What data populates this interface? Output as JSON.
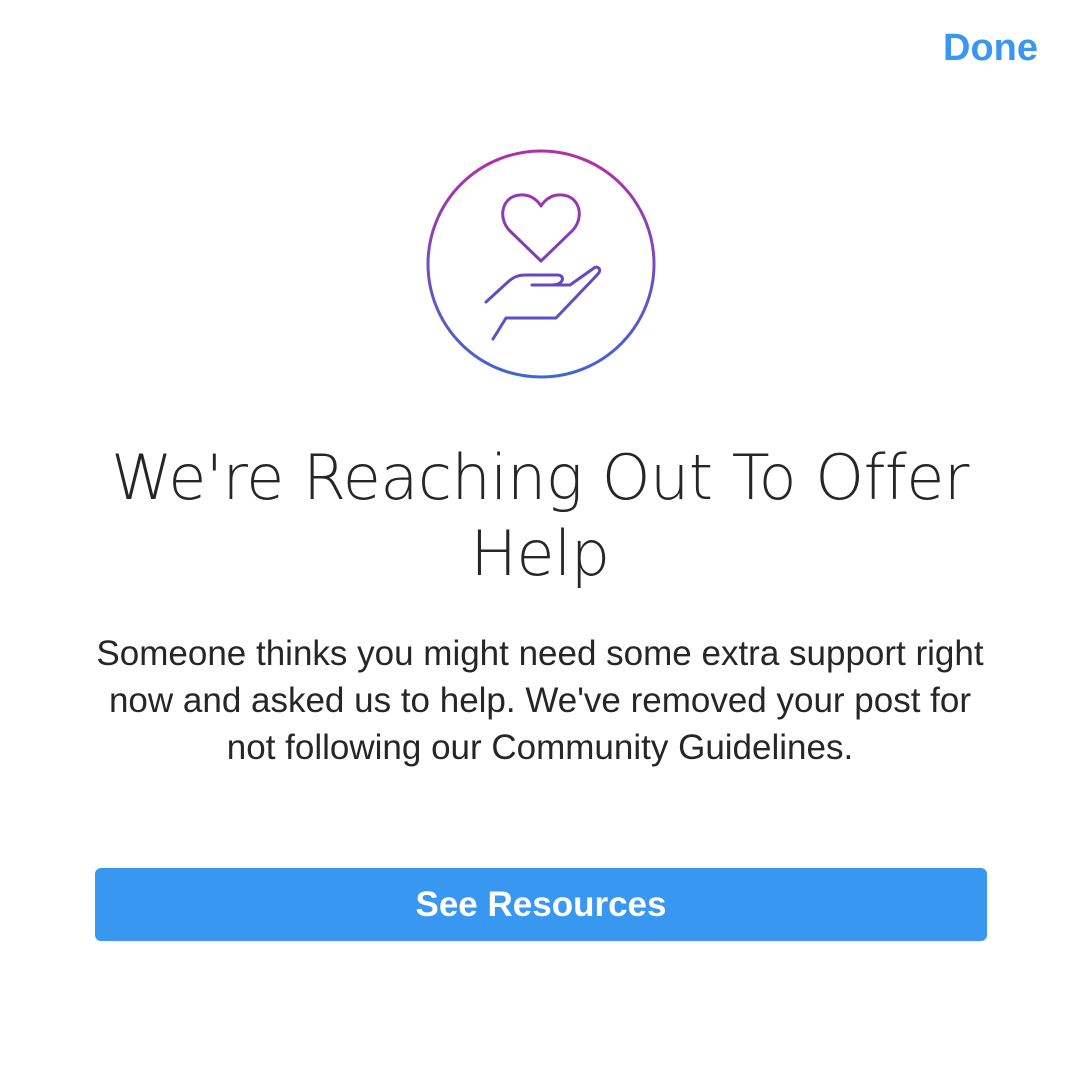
{
  "header": {
    "done_label": "Done"
  },
  "icon": {
    "name": "heart-in-hand-icon",
    "gradient_start": "#b22fa8",
    "gradient_end": "#3f66d1"
  },
  "main": {
    "title": "We're Reaching Out To Offer Help",
    "message": "Someone thinks you might need some extra support right now and asked us to help. We've removed your post for not following our Community Guidelines."
  },
  "actions": {
    "see_resources_label": "See Resources"
  },
  "colors": {
    "accent": "#3897f0",
    "text": "#262626",
    "background": "#ffffff"
  }
}
